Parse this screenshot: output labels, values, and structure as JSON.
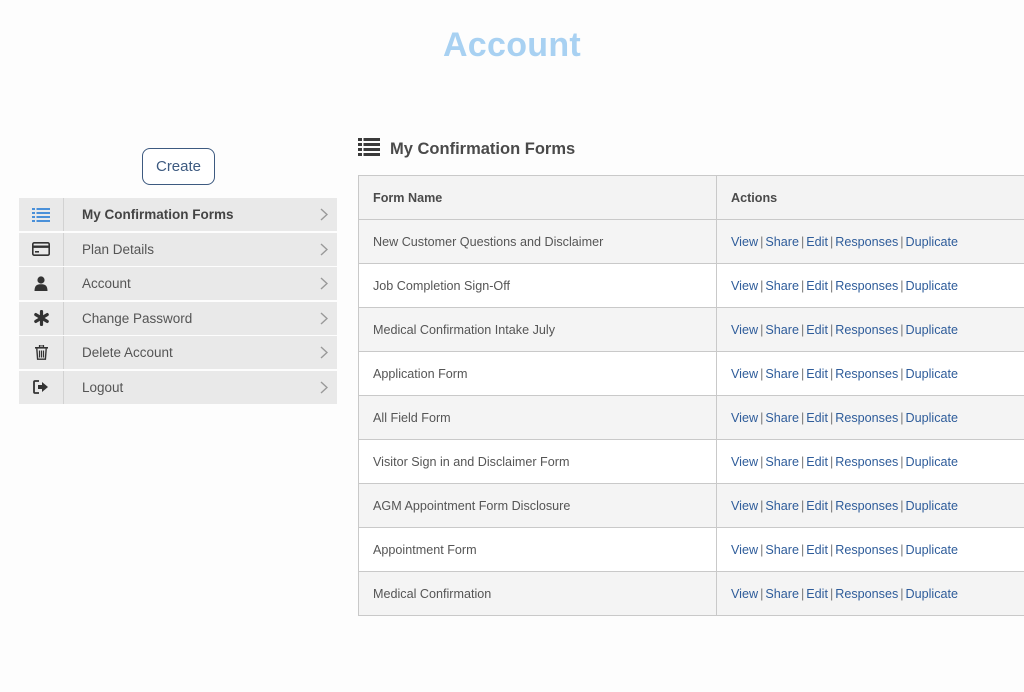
{
  "page": {
    "title": "Account"
  },
  "create_button": {
    "label": "Create"
  },
  "sidebar": {
    "items": [
      {
        "label": "My Confirmation Forms",
        "icon": "list-icon",
        "active": true
      },
      {
        "label": "Plan Details",
        "icon": "credit-card-icon",
        "active": false
      },
      {
        "label": "Account",
        "icon": "user-icon",
        "active": false
      },
      {
        "label": "Change Password",
        "icon": "asterisk-icon",
        "active": false
      },
      {
        "label": "Delete Account",
        "icon": "trash-icon",
        "active": false
      },
      {
        "label": "Logout",
        "icon": "sign-out-icon",
        "active": false
      }
    ]
  },
  "main": {
    "heading": "My Confirmation Forms",
    "heading_icon": "list-icon",
    "table": {
      "columns": [
        "Form Name",
        "Actions"
      ],
      "actions": [
        "View",
        "Share",
        "Edit",
        "Responses",
        "Duplicate"
      ],
      "separator": "|",
      "rows": [
        {
          "name": "New Customer Questions and Disclaimer"
        },
        {
          "name": "Job Completion Sign-Off"
        },
        {
          "name": "Medical Confirmation Intake July"
        },
        {
          "name": "Application Form"
        },
        {
          "name": "All Field Form"
        },
        {
          "name": "Visitor Sign in and Disclaimer Form"
        },
        {
          "name": "AGM Appointment Form Disclosure"
        },
        {
          "name": "Appointment Form"
        },
        {
          "name": "Medical Confirmation"
        }
      ]
    }
  },
  "colors": {
    "title": "#a8d1f2",
    "link": "#2e5c9a",
    "active_icon": "#4a90d9",
    "sidebar_bg": "#e9e9e9",
    "button_border": "#3d5a80"
  }
}
